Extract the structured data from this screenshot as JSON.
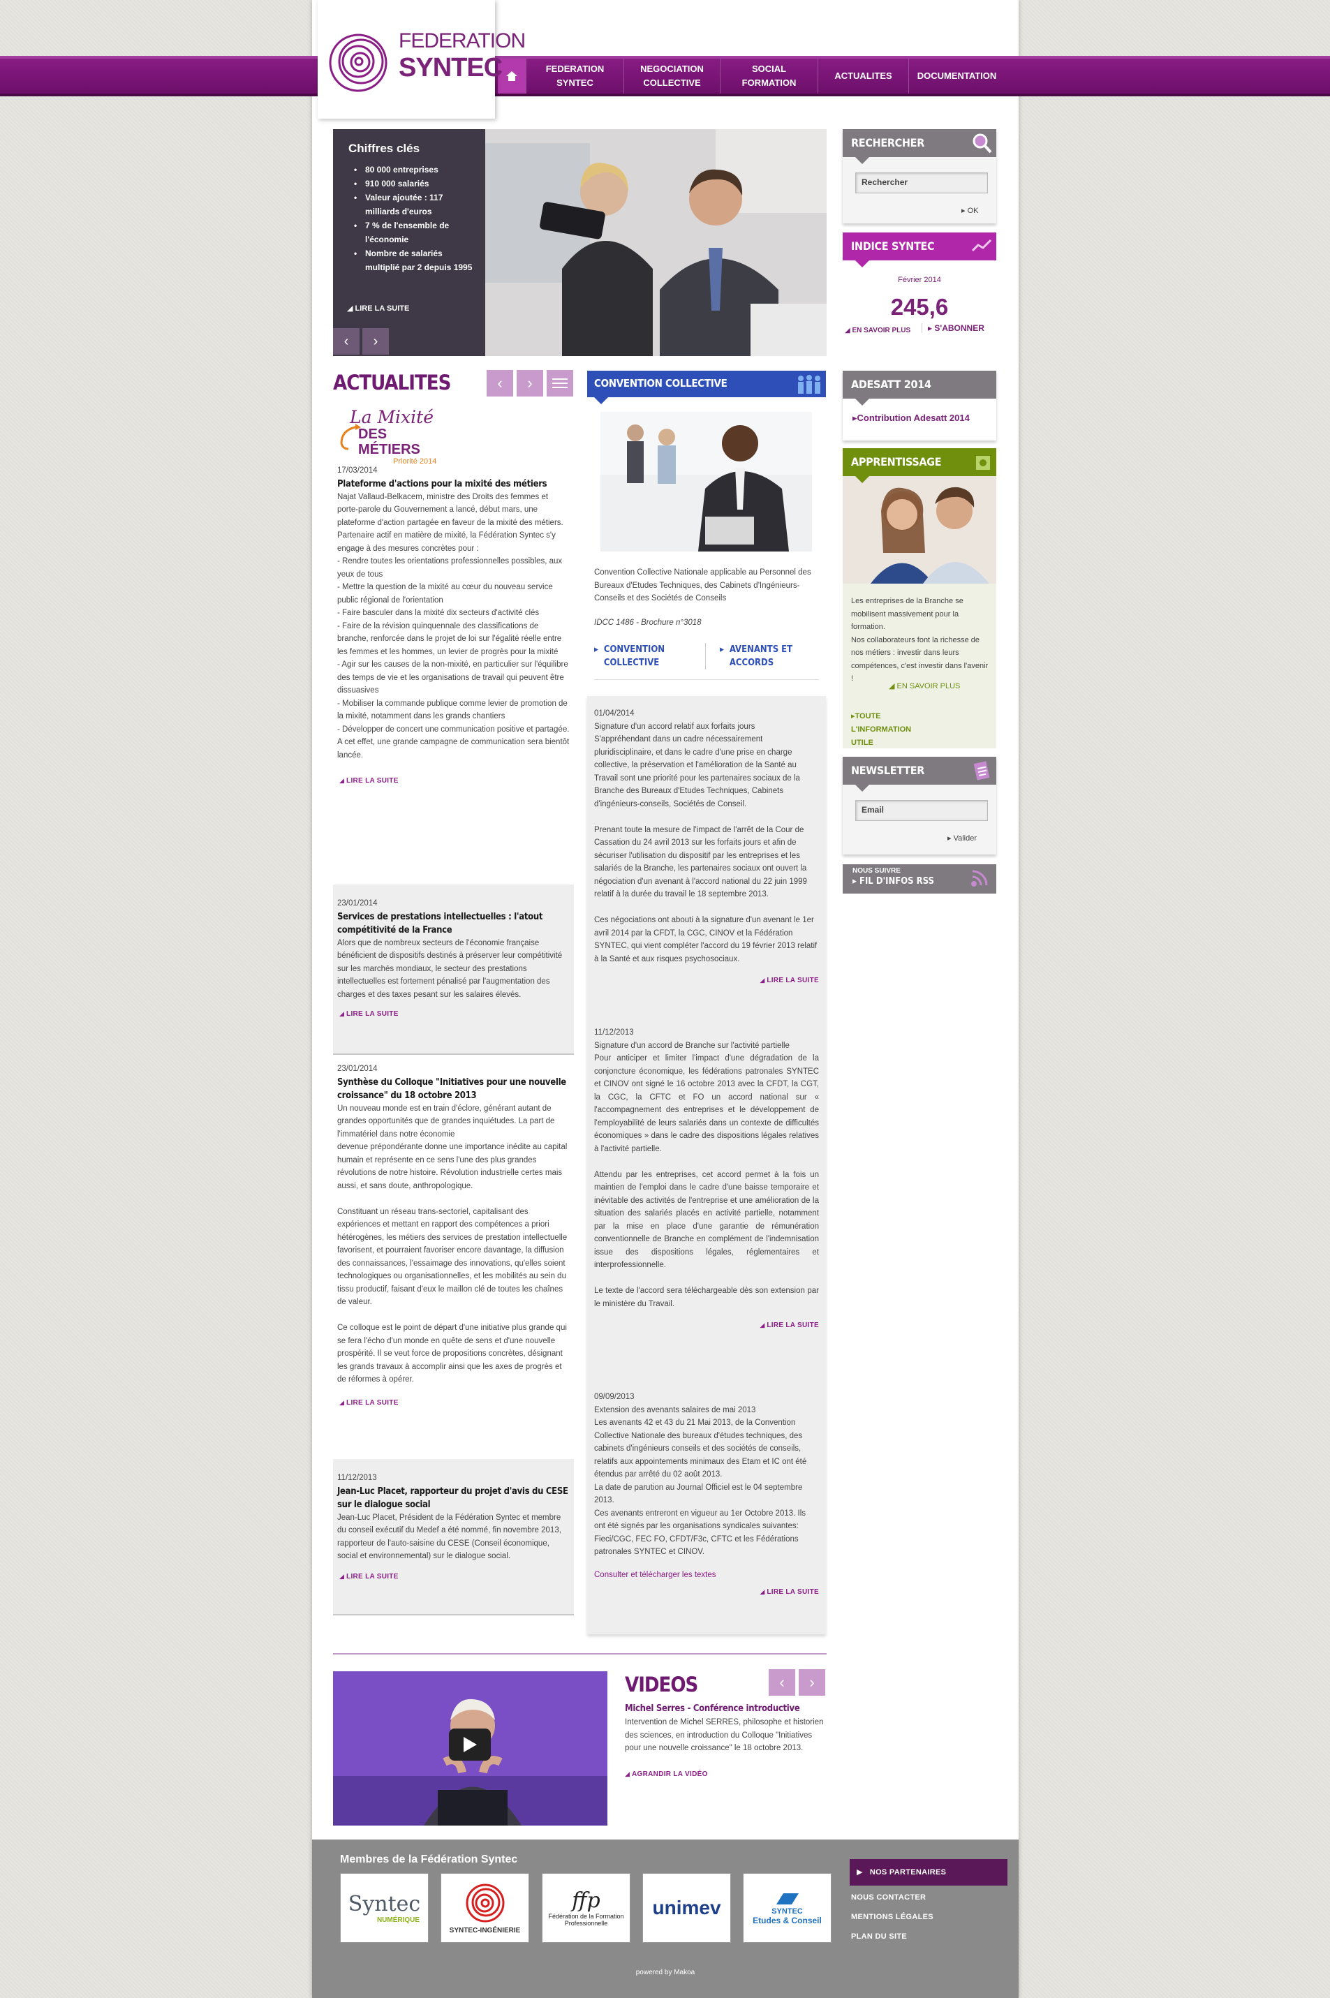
{
  "logo": {
    "line1": "FEDERATION",
    "line2": "SYNTEC"
  },
  "nav": {
    "items": [
      {
        "label": "FEDERATION SYNTEC",
        "w": 140
      },
      {
        "label": "NEGOCIATION COLLECTIVE",
        "w": 138
      },
      {
        "label": "SOCIAL FORMATION",
        "w": 140
      },
      {
        "label": "ACTUALITES",
        "w": 130
      },
      {
        "label": "DOCUMENTATION",
        "w": 138
      }
    ]
  },
  "colors": {
    "purple": "#7a2277",
    "mid_blue": "#2e4fb8",
    "green": "#6f8f0d",
    "gray_head": "#7e7a80"
  },
  "slider": {
    "title": "Chiffres clés",
    "items": [
      "80 000 entreprises",
      "910 000 salariés",
      "Valeur ajoutée : 117 milliards d'euros",
      "7 % de l'ensemble de l'économie",
      "Nombre de salariés multiplié par 2 depuis 1995"
    ],
    "more": "LIRE LA SUITE"
  },
  "actualites": {
    "title": "ACTUALITES",
    "logo_top": "La Mixité",
    "logo_mid": "DES MÉTIERS",
    "logo_sub": "Priorité 2014",
    "more": "LIRE LA SUITE",
    "articles": [
      {
        "date": "17/03/2014",
        "title": "Plateforme d'actions pour la mixité des métiers",
        "body": "Najat Vallaud-Belkacem, ministre des Droits des femmes et porte-parole du Gouvernement a lancé, début mars, une plateforme d'action partagée en faveur de la mixité des métiers.\nPartenaire actif en matière de mixité, la Fédération Syntec s'y engage à des mesures concrètes pour :\n- Rendre toutes les orientations professionnelles possibles, aux yeux de tous\n- Mettre la question de la mixité au cœur du nouveau service public régional de l'orientation\n- Faire basculer dans la mixité dix secteurs d'activité clés\n- Faire de la révision quinquennale des classifications de branche, renforcée dans le projet de loi sur l'égalité réelle entre les femmes et les hommes, un levier de progrès pour la mixité\n- Agir sur les causes de la non-mixité, en particulier sur l'équilibre des temps de vie et les organisations de travail qui peuvent être dissuasives\n- Mobiliser la commande publique comme levier de promotion de la mixité, notamment dans les grands chantiers\n- Développer de concert une communication positive et partagée.\nA cet effet, une grande campagne de communication sera bientôt lancée."
      },
      {
        "date": "23/01/2014",
        "title": "Services de prestations intellectuelles : l'atout compétitivité de la France",
        "body": "Alors que de nombreux secteurs de l'économie française bénéficient de dispositifs destinés à préserver leur compétitivité sur les marchés mondiaux, le secteur des prestations intellectuelles est fortement pénalisé par l'augmentation des charges et des taxes pesant sur les salaires élevés."
      },
      {
        "date": "23/01/2014",
        "title": "Synthèse du Colloque \"Initiatives pour une nouvelle croissance\" du 18 octobre 2013",
        "body": "Un nouveau monde est en train d'éclore, générant autant de grandes opportunités que de grandes inquiétudes. La part de l'immatériel dans notre économie\ndevenue prépondérante donne une importance inédite au capital humain et représente en ce sens l'une des plus grandes révolutions de notre histoire. Révolution industrielle certes mais aussi, et sans doute, anthropologique.\n\nConstituant un réseau trans-sectoriel, capitalisant des expériences et mettant en rapport des compétences a priori hétérogènes, les métiers des services de prestation intellectuelle favorisent, et pourraient favoriser encore davantage, la diffusion des connaissances, l'essaimage des innovations, qu'elles soient technologiques ou organisationnelles, et les mobilités au sein du tissu productif, faisant d'eux le maillon clé de toutes les chaînes de valeur.\n\nCe colloque est le point de départ d'une initiative plus grande qui se fera l'écho d'un monde en quête de sens et d'une nouvelle prospérité. Il se veut force de propositions concrètes, désignant les grands travaux à accomplir ainsi que les axes de progrès et de réformes à opérer."
      },
      {
        "date": "11/12/2013",
        "title": "Jean-Luc Placet, rapporteur du projet d'avis du CESE sur le dialogue social",
        "body": "Jean-Luc Placet, Président de la Fédération Syntec et membre du conseil exécutif du Medef a été nommé, fin novembre 2013, rapporteur de l'auto-saisine du CESE (Conseil économique, social et environnemental) sur le dialogue social."
      }
    ]
  },
  "convention": {
    "title": "CONVENTION COLLECTIVE",
    "desc": "Convention Collective Nationale applicable au Personnel des Bureaux d'Etudes Techniques, des Cabinets d'Ingénieurs-Conseils et des Sociétés de Conseils",
    "idcc": "IDCC 1486 - Brochure n°3018",
    "link1": "CONVENTION COLLECTIVE",
    "link2": "AVENANTS ET ACCORDS",
    "more": "LIRE LA SUITE",
    "articles": [
      {
        "date": "01/04/2014",
        "title": "Signature d'un accord relatif aux forfaits jours",
        "body": "S'appréhendant dans un cadre nécessairement pluridisciplinaire, et dans le cadre d'une prise en charge collective, la préservation et l'amélioration de la Santé au Travail sont une priorité pour les partenaires sociaux de la Branche des Bureaux d'Etudes Techniques, Cabinets d'ingénieurs-conseils, Sociétés de Conseil.\n\nPrenant toute la mesure de l'impact de l'arrêt de la Cour de Cassation du 24 avril 2013 sur les forfaits jours et afin de sécuriser l'utilisation du dispositif par les entreprises et les salariés de la Branche, les partenaires sociaux ont ouvert la négociation d'un avenant à l'accord national du 22 juin 1999 relatif à la durée du travail le 18 septembre 2013.\n\nCes négociations ont abouti à la signature d'un avenant le 1er avril 2014 par la CFDT, la CGC, CINOV et la Fédération SYNTEC, qui vient compléter l'accord du 19 février 2013 relatif à la Santé et aux risques psychosociaux."
      },
      {
        "date": "11/12/2013",
        "title": "Signature d'un accord de Branche sur l'activité partielle",
        "body": "Pour anticiper et limiter l'impact d'une dégradation de la conjoncture économique, les fédérations patronales SYNTEC et CINOV ont signé le 16 octobre 2013 avec la CFDT, la CGT, la CGC, la CFTC et FO un accord national sur « l'accompagnement des entreprises et le développement de l'employabilité de leurs salariés dans un contexte de difficultés économiques » dans le cadre des dispositions légales relatives à l'activité partielle.\n\nAttendu par les entreprises, cet accord permet à la fois un maintien de l'emploi dans le cadre d'une baisse temporaire et inévitable des activités de l'entreprise et une amélioration de la situation des salariés placés en activité partielle, notamment par la mise en place d'une garantie de rémunération conventionnelle de Branche en complément de l'indemnisation issue des dispositions légales, réglementaires et interprofessionnelle.\n\nLe texte de l'accord sera téléchargeable dès son extension par le ministère du Travail."
      },
      {
        "date": "09/09/2013",
        "title": "Extension des avenants salaires de mai 2013",
        "body": "Les avenants 42 et 43 du 21 Mai 2013, de la Convention Collective Nationale des bureaux d'études techniques, des cabinets d'ingénieurs conseils et des sociétés de conseils, relatifs aux appointements minimaux des Etam et IC ont été étendus par arrêté du 02 août 2013.\nLa date de parution au Journal Officiel est le 04 septembre 2013.\nCes avenants entreront en vigueur au 1er Octobre 2013. Ils ont été signés par les organisations syndicales suivantes: Fieci/CGC, FEC FO, CFDT/F3c, CFTC et les Fédérations patronales SYNTEC et CINOV.",
        "link": "Consulter et télécharger les textes"
      }
    ]
  },
  "sidebar": {
    "search": {
      "title": "RECHERCHER",
      "placeholder": "Rechercher",
      "ok": "OK"
    },
    "indice": {
      "title": "INDICE SYNTEC",
      "month": "Février 2014",
      "value": "245,6",
      "more": "EN SAVOIR PLUS",
      "sub": "S'ABONNER"
    },
    "adesatt": {
      "title": "ADESATT 2014",
      "link": "Contribution Adesatt 2014"
    },
    "apprentissage": {
      "title": "APPRENTISSAGE",
      "text": "Les entreprises de la Branche se mobilisent massivement pour la formation.\nNos collaborateurs font la richesse de nos métiers : investir dans leurs compétences, c'est investir dans l'avenir !",
      "more": "EN SAVOIR PLUS",
      "link": "TOUTE L'INFORMATION UTILE"
    },
    "newsletter": {
      "title": "NEWSLETTER",
      "placeholder": "Email",
      "valider": "Valider"
    },
    "rss": {
      "top": "NOUS SUIVRE",
      "label": "FIL D'INFOS RSS"
    }
  },
  "videos": {
    "title": "VIDEOS",
    "vtitle": "Michel Serres - Conférence introductive",
    "desc": "Intervention de Michel SERRES, philosophe et historien des sciences, en introduction du Colloque \"Initiatives pour une nouvelle croissance\" le 18 octobre 2013.",
    "more": "AGRANDIR LA VIDÉO"
  },
  "footer": {
    "title": "Membres de la Fédération Syntec",
    "members": [
      {
        "name": "Syntec",
        "sub": "NUMÉRIQUE"
      },
      {
        "name": "",
        "sub": "SYNTEC-INGÉNIERIE"
      },
      {
        "name": "ffp",
        "sub": "Fédération de la Formation Professionnelle"
      },
      {
        "name": "unimev",
        "sub": ""
      },
      {
        "name": "SYNTEC",
        "sub": "Etudes & Conseil"
      }
    ],
    "partners": "NOS PARTENAIRES",
    "contact": "NOUS CONTACTER",
    "legal": "MENTIONS LÉGALES",
    "plan": "PLAN DU SITE",
    "powered": "powered by Makoa"
  }
}
